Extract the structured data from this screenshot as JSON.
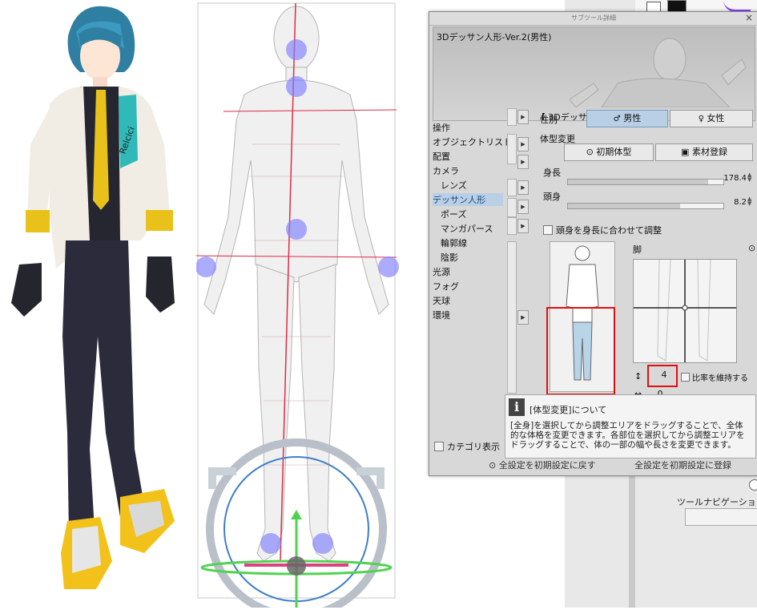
{
  "panel": {
    "title": "サブツール詳細",
    "close_glyph": "×",
    "preview_name": "3Dデッサン人形-Ver.2(男性)",
    "editing_label": "【 3Dデッサン人形編集中 】"
  },
  "categories": [
    {
      "label": "操作",
      "indent": 0,
      "selected": false
    },
    {
      "label": "オブジェクトリスト",
      "indent": 0,
      "selected": false
    },
    {
      "label": "配置",
      "indent": 0,
      "selected": false
    },
    {
      "label": "カメラ",
      "indent": 0,
      "selected": false
    },
    {
      "label": "レンズ",
      "indent": 1,
      "selected": false
    },
    {
      "label": "デッサン人形",
      "indent": 0,
      "selected": true
    },
    {
      "label": "ポーズ",
      "indent": 1,
      "selected": false
    },
    {
      "label": "マンガパース",
      "indent": 1,
      "selected": false
    },
    {
      "label": "輪郭線",
      "indent": 1,
      "selected": false
    },
    {
      "label": "陰影",
      "indent": 1,
      "selected": false
    },
    {
      "label": "光源",
      "indent": 0,
      "selected": false
    },
    {
      "label": "フォグ",
      "indent": 0,
      "selected": false
    },
    {
      "label": "天球",
      "indent": 0,
      "selected": false
    },
    {
      "label": "環境",
      "indent": 0,
      "selected": false
    }
  ],
  "category_toggle_label": "カテゴリ表示",
  "gender": {
    "label": "性別",
    "male": "男性",
    "female": "女性",
    "selected": "男性"
  },
  "body_shape": {
    "section_label": "体型変更",
    "reset_button": "初期体型",
    "register_button": "素材登録",
    "height_label": "身長",
    "height_value": "178.4",
    "height_fraction": 0.9,
    "head_label": "頭身",
    "head_value": "8.2",
    "head_fraction": 0.72,
    "fit_checkbox_label": "頭身を身長に合わせて調整",
    "part_label": "脚",
    "vertical_value": "4",
    "horizontal_value": "0",
    "ratio_checkbox_label": "比率を維持する",
    "vertical_arrow": "↕",
    "horizontal_arrow": "↔"
  },
  "info": {
    "title": "[体型変更]について",
    "body": "[全身]を選択してから調整エリアをドラッグすることで、全体的な体格を変更できます。各部位を選択してから調整エリアをドラッグすることで、体の一部の幅や長さを変更できます。"
  },
  "footer": {
    "reset_all": "全設定を初期設定に戻す",
    "register_all": "全設定を初期設定に登録"
  },
  "app_right": {
    "tool_navigation_label": "ツールナビゲーション"
  },
  "colors": {
    "selected_bg": "#b9cfe6",
    "highlight_red": "#e01010",
    "handle_blue": "#7f7fff"
  }
}
